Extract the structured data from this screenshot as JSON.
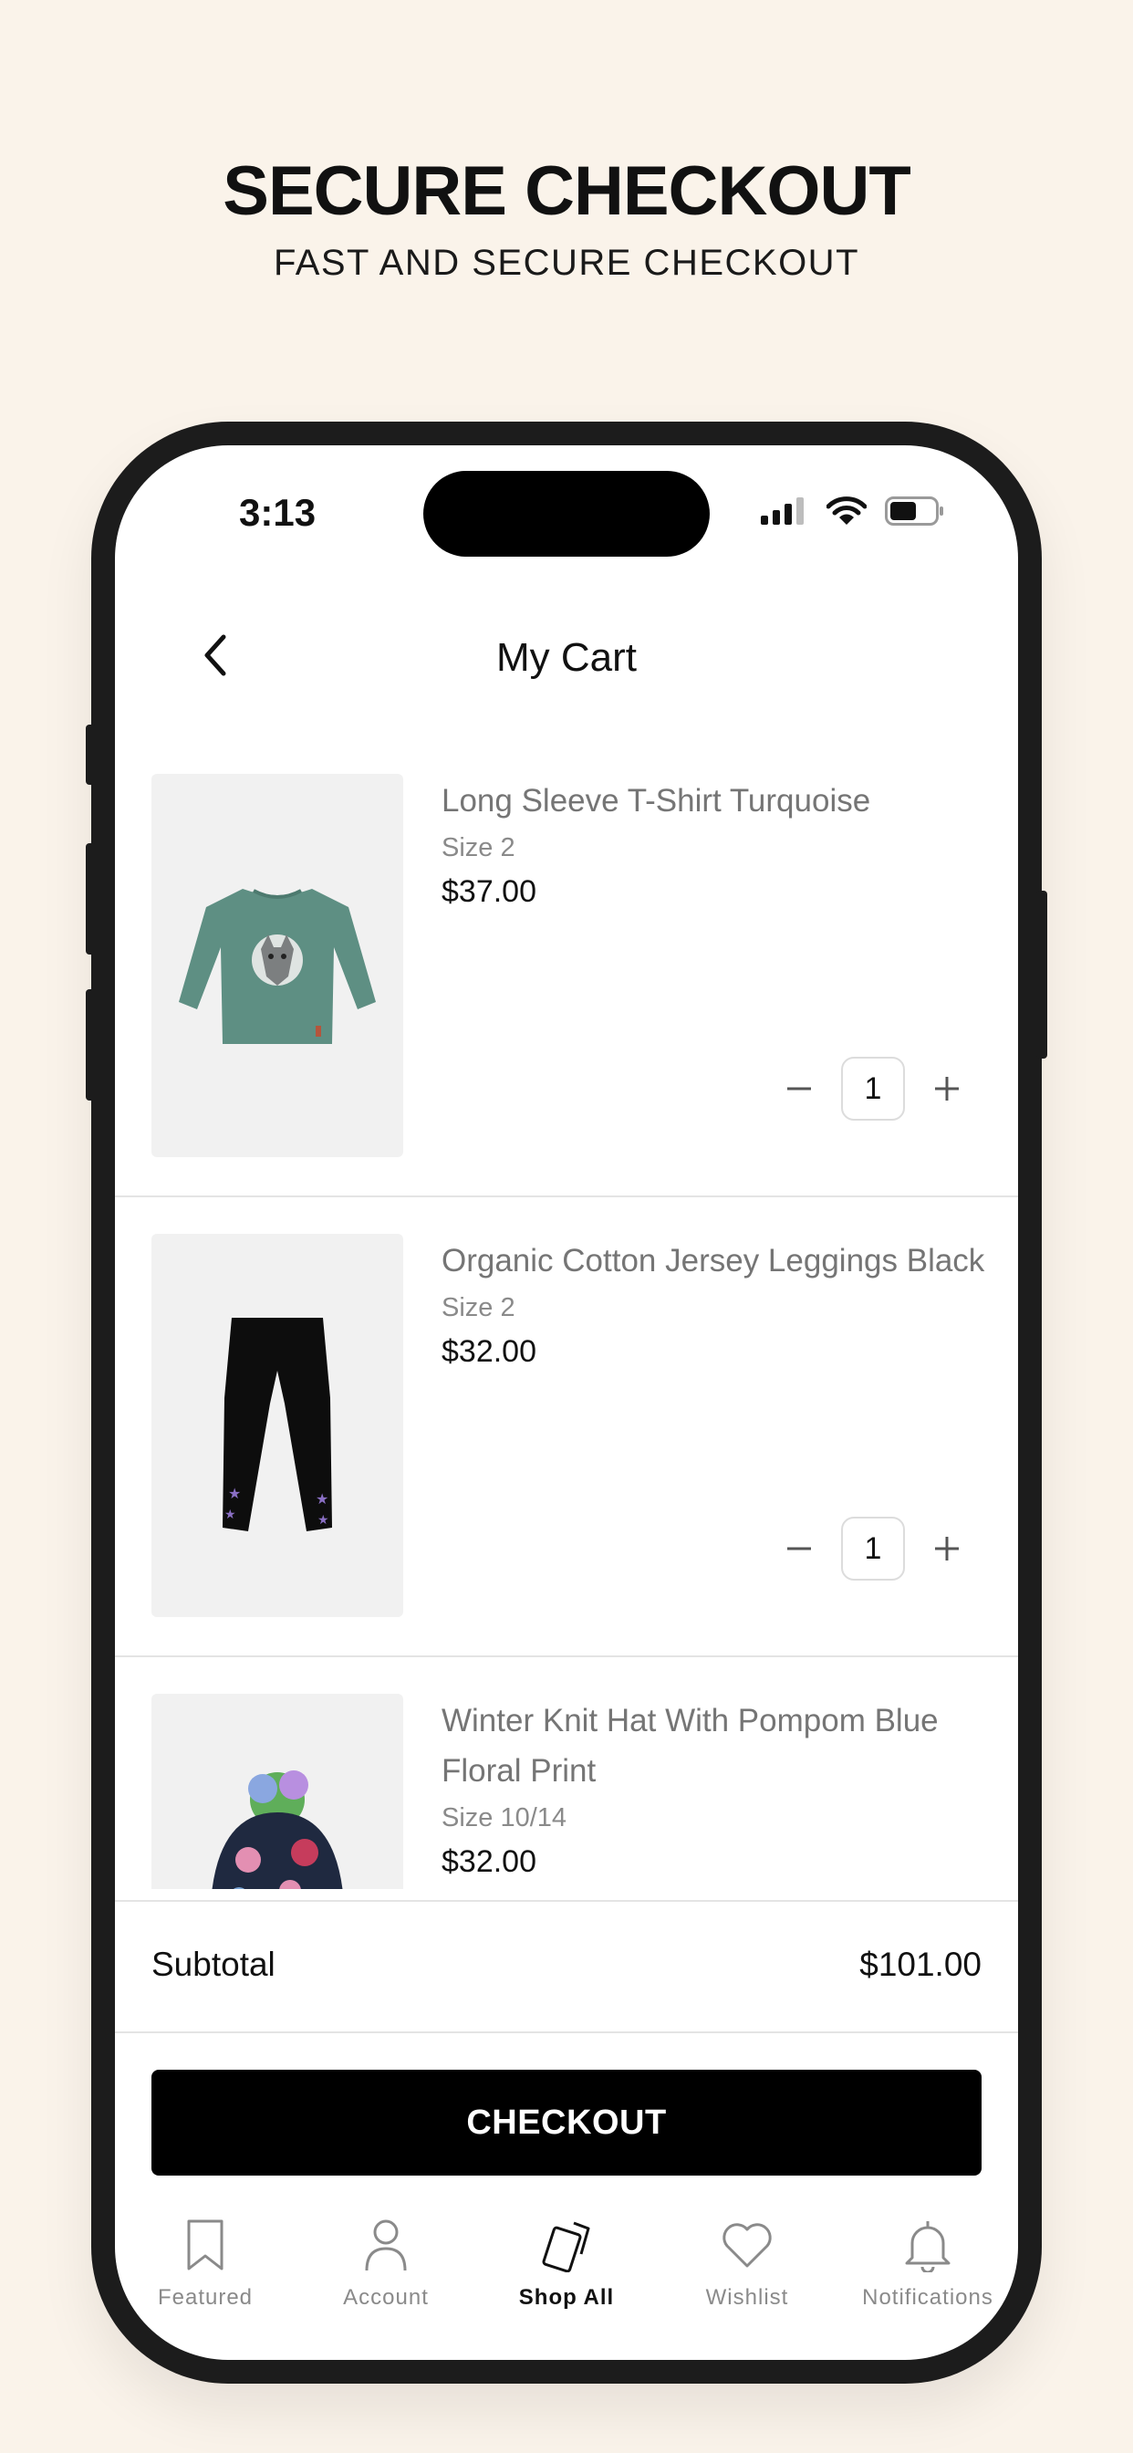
{
  "promo": {
    "headline": "SECURE CHECKOUT",
    "subheadline": "FAST AND SECURE CHECKOUT"
  },
  "status_bar": {
    "time": "3:13"
  },
  "header": {
    "title": "My Cart"
  },
  "cart": {
    "items": [
      {
        "name": "Long Sleeve T-Shirt Turquoise",
        "size": "Size 2",
        "price": "$37.00",
        "quantity": "1"
      },
      {
        "name": "Organic Cotton Jersey Leggings Black",
        "size": "Size 2",
        "price": "$32.00",
        "quantity": "1"
      },
      {
        "name": "Winter Knit Hat With Pompom Blue Floral Print",
        "size": "Size 10/14",
        "price": "$32.00"
      }
    ]
  },
  "summary": {
    "subtotal_label": "Subtotal",
    "subtotal_value": "$101.00"
  },
  "checkout": {
    "label": "CHECKOUT"
  },
  "tabbar": {
    "items": [
      {
        "label": "Featured",
        "icon": "bookmark-icon"
      },
      {
        "label": "Account",
        "icon": "person-icon"
      },
      {
        "label": "Shop All",
        "icon": "cards-icon",
        "active": true
      },
      {
        "label": "Wishlist",
        "icon": "heart-icon"
      },
      {
        "label": "Notifications",
        "icon": "bell-icon"
      }
    ]
  },
  "colors": {
    "background": "#faf3ea",
    "accent": "#000000",
    "frame": "#1c1c1c"
  }
}
